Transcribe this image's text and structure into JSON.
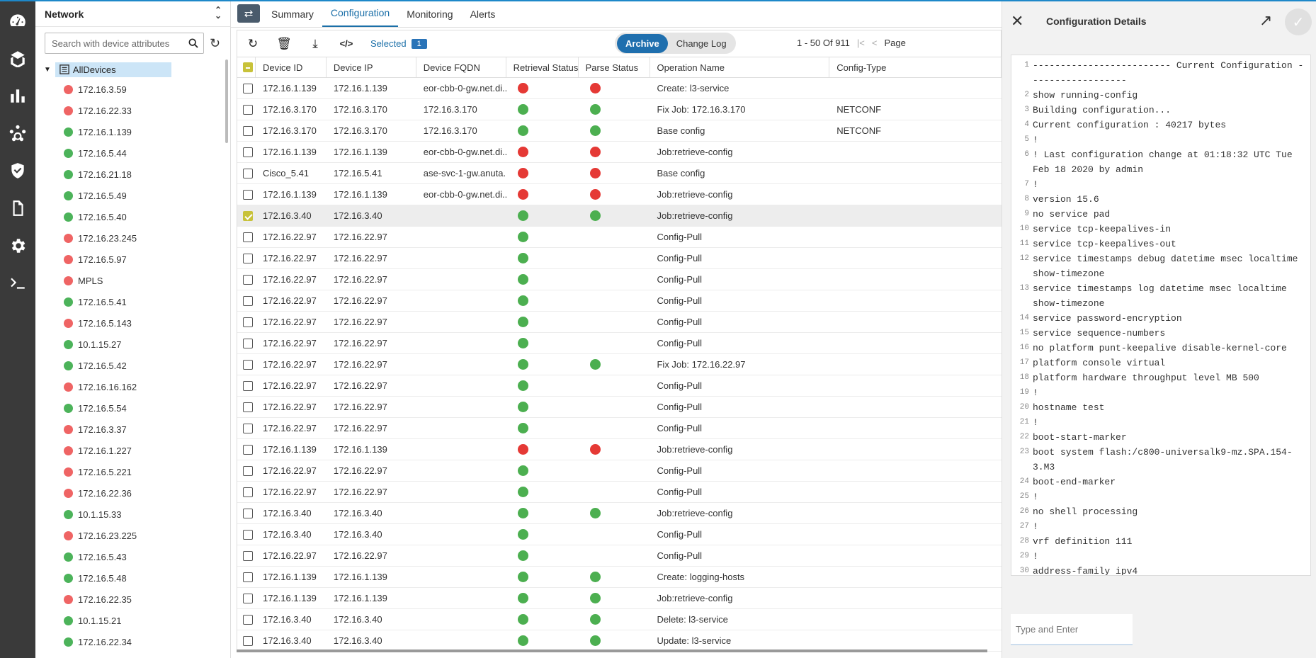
{
  "colors": {
    "accent": "#1b6fa8",
    "rail": "#3a3a3a",
    "red": "#e53935",
    "green": "#4caf50",
    "selected_check": "#c8c23a"
  },
  "rail": {
    "icons": [
      "dashboard-icon",
      "deploy-icon",
      "chart-icon",
      "topology-icon",
      "shield-icon",
      "document-icon",
      "gear-icon",
      "terminal-icon"
    ]
  },
  "tree": {
    "title": "Network",
    "search_placeholder": "Search with device attributes",
    "root_label": "AllDevices",
    "items": [
      {
        "label": "172.16.3.59",
        "status": "red"
      },
      {
        "label": "172.16.22.33",
        "status": "red"
      },
      {
        "label": "172.16.1.139",
        "status": "green"
      },
      {
        "label": "172.16.5.44",
        "status": "green"
      },
      {
        "label": "172.16.21.18",
        "status": "green"
      },
      {
        "label": "172.16.5.49",
        "status": "green"
      },
      {
        "label": "172.16.5.40",
        "status": "green"
      },
      {
        "label": "172.16.23.245",
        "status": "red"
      },
      {
        "label": "172.16.5.97",
        "status": "red"
      },
      {
        "label": "MPLS",
        "status": "red"
      },
      {
        "label": "172.16.5.41",
        "status": "green"
      },
      {
        "label": "172.16.5.143",
        "status": "red"
      },
      {
        "label": "10.1.15.27",
        "status": "green"
      },
      {
        "label": "172.16.5.42",
        "status": "green"
      },
      {
        "label": "172.16.16.162",
        "status": "red"
      },
      {
        "label": "172.16.5.54",
        "status": "green"
      },
      {
        "label": "172.16.3.37",
        "status": "red"
      },
      {
        "label": "172.16.1.227",
        "status": "red"
      },
      {
        "label": "172.16.5.221",
        "status": "red"
      },
      {
        "label": "172.16.22.36",
        "status": "red"
      },
      {
        "label": "10.1.15.33",
        "status": "green"
      },
      {
        "label": "172.16.23.225",
        "status": "red"
      },
      {
        "label": "172.16.5.43",
        "status": "green"
      },
      {
        "label": "172.16.5.48",
        "status": "green"
      },
      {
        "label": "172.16.22.35",
        "status": "red"
      },
      {
        "label": "10.1.15.21",
        "status": "green"
      },
      {
        "label": "172.16.22.34",
        "status": "green"
      }
    ]
  },
  "tabs": [
    "Summary",
    "Configuration",
    "Monitoring",
    "Alerts"
  ],
  "toolbar": {
    "selected_label": "Selected",
    "selected_count": "1",
    "archive_label": "Archive",
    "changelog_label": "Change Log",
    "range": "1 - 50 Of 911",
    "page_label": "Page"
  },
  "grid": {
    "headers": [
      "Device ID",
      "Device IP",
      "Device FQDN",
      "Retrieval Status",
      "Parse Status",
      "Operation Name",
      "Config-Type"
    ],
    "rows": [
      {
        "id": "172.16.1.139",
        "ip": "172.16.1.139",
        "fqdn": "eor-cbb-0-gw.net.di...",
        "ret": "red",
        "parse": "red",
        "op": "Create: l3-service",
        "type": "",
        "checked": false
      },
      {
        "id": "172.16.3.170",
        "ip": "172.16.3.170",
        "fqdn": "172.16.3.170",
        "ret": "green",
        "parse": "green",
        "op": "Fix Job: 172.16.3.170",
        "type": "NETCONF",
        "checked": false
      },
      {
        "id": "172.16.3.170",
        "ip": "172.16.3.170",
        "fqdn": "172.16.3.170",
        "ret": "green",
        "parse": "green",
        "op": "Base config",
        "type": "NETCONF",
        "checked": false
      },
      {
        "id": "172.16.1.139",
        "ip": "172.16.1.139",
        "fqdn": "eor-cbb-0-gw.net.di...",
        "ret": "red",
        "parse": "red",
        "op": "Job:retrieve-config",
        "type": "",
        "checked": false
      },
      {
        "id": "Cisco_5.41",
        "ip": "172.16.5.41",
        "fqdn": "ase-svc-1-gw.anuta...",
        "ret": "red",
        "parse": "red",
        "op": "Base config",
        "type": "",
        "checked": false
      },
      {
        "id": "172.16.1.139",
        "ip": "172.16.1.139",
        "fqdn": "eor-cbb-0-gw.net.di...",
        "ret": "red",
        "parse": "red",
        "op": "Job:retrieve-config",
        "type": "",
        "checked": false
      },
      {
        "id": "172.16.3.40",
        "ip": "172.16.3.40",
        "fqdn": "",
        "ret": "green",
        "parse": "green",
        "op": "Job:retrieve-config",
        "type": "",
        "checked": true
      },
      {
        "id": "172.16.22.97",
        "ip": "172.16.22.97",
        "fqdn": "",
        "ret": "green",
        "parse": "",
        "op": "Config-Pull",
        "type": "",
        "checked": false
      },
      {
        "id": "172.16.22.97",
        "ip": "172.16.22.97",
        "fqdn": "",
        "ret": "green",
        "parse": "",
        "op": "Config-Pull",
        "type": "",
        "checked": false
      },
      {
        "id": "172.16.22.97",
        "ip": "172.16.22.97",
        "fqdn": "",
        "ret": "green",
        "parse": "",
        "op": "Config-Pull",
        "type": "",
        "checked": false
      },
      {
        "id": "172.16.22.97",
        "ip": "172.16.22.97",
        "fqdn": "",
        "ret": "green",
        "parse": "",
        "op": "Config-Pull",
        "type": "",
        "checked": false
      },
      {
        "id": "172.16.22.97",
        "ip": "172.16.22.97",
        "fqdn": "",
        "ret": "green",
        "parse": "",
        "op": "Config-Pull",
        "type": "",
        "checked": false
      },
      {
        "id": "172.16.22.97",
        "ip": "172.16.22.97",
        "fqdn": "",
        "ret": "green",
        "parse": "",
        "op": "Config-Pull",
        "type": "",
        "checked": false
      },
      {
        "id": "172.16.22.97",
        "ip": "172.16.22.97",
        "fqdn": "",
        "ret": "green",
        "parse": "green",
        "op": "Fix Job: 172.16.22.97",
        "type": "",
        "checked": false
      },
      {
        "id": "172.16.22.97",
        "ip": "172.16.22.97",
        "fqdn": "",
        "ret": "green",
        "parse": "",
        "op": "Config-Pull",
        "type": "",
        "checked": false
      },
      {
        "id": "172.16.22.97",
        "ip": "172.16.22.97",
        "fqdn": "",
        "ret": "green",
        "parse": "",
        "op": "Config-Pull",
        "type": "",
        "checked": false
      },
      {
        "id": "172.16.22.97",
        "ip": "172.16.22.97",
        "fqdn": "",
        "ret": "green",
        "parse": "",
        "op": "Config-Pull",
        "type": "",
        "checked": false
      },
      {
        "id": "172.16.1.139",
        "ip": "172.16.1.139",
        "fqdn": "",
        "ret": "red",
        "parse": "red",
        "op": "Job:retrieve-config",
        "type": "",
        "checked": false
      },
      {
        "id": "172.16.22.97",
        "ip": "172.16.22.97",
        "fqdn": "",
        "ret": "green",
        "parse": "",
        "op": "Config-Pull",
        "type": "",
        "checked": false
      },
      {
        "id": "172.16.22.97",
        "ip": "172.16.22.97",
        "fqdn": "",
        "ret": "green",
        "parse": "",
        "op": "Config-Pull",
        "type": "",
        "checked": false
      },
      {
        "id": "172.16.3.40",
        "ip": "172.16.3.40",
        "fqdn": "",
        "ret": "green",
        "parse": "green",
        "op": "Job:retrieve-config",
        "type": "",
        "checked": false
      },
      {
        "id": "172.16.3.40",
        "ip": "172.16.3.40",
        "fqdn": "",
        "ret": "green",
        "parse": "",
        "op": "Config-Pull",
        "type": "",
        "checked": false
      },
      {
        "id": "172.16.22.97",
        "ip": "172.16.22.97",
        "fqdn": "",
        "ret": "green",
        "parse": "",
        "op": "Config-Pull",
        "type": "",
        "checked": false
      },
      {
        "id": "172.16.1.139",
        "ip": "172.16.1.139",
        "fqdn": "",
        "ret": "green",
        "parse": "green",
        "op": "Create: logging-hosts",
        "type": "",
        "checked": false
      },
      {
        "id": "172.16.1.139",
        "ip": "172.16.1.139",
        "fqdn": "",
        "ret": "green",
        "parse": "green",
        "op": "Job:retrieve-config",
        "type": "",
        "checked": false
      },
      {
        "id": "172.16.3.40",
        "ip": "172.16.3.40",
        "fqdn": "",
        "ret": "green",
        "parse": "green",
        "op": "Delete: l3-service",
        "type": "",
        "checked": false
      },
      {
        "id": "172.16.3.40",
        "ip": "172.16.3.40",
        "fqdn": "",
        "ret": "green",
        "parse": "green",
        "op": "Update: l3-service",
        "type": "",
        "checked": false
      }
    ]
  },
  "panel": {
    "title": "Configuration Details",
    "input_placeholder": "Type and Enter",
    "lines": [
      {
        "n": "1",
        "t": "------------------------- Current Configuration ------------------"
      },
      {
        "n": "2",
        "t": "show running-config"
      },
      {
        "n": "3",
        "t": "Building configuration..."
      },
      {
        "n": "4",
        "t": "Current configuration : 40217 bytes"
      },
      {
        "n": "5",
        "t": "!"
      },
      {
        "n": "6",
        "t": "! Last configuration change at 01:18:32 UTC Tue Feb 18 2020 by admin"
      },
      {
        "n": "7",
        "t": "!"
      },
      {
        "n": "8",
        "t": "version 15.6"
      },
      {
        "n": "9",
        "t": "no service pad"
      },
      {
        "n": "10",
        "t": "service tcp-keepalives-in"
      },
      {
        "n": "11",
        "t": "service tcp-keepalives-out"
      },
      {
        "n": "12",
        "t": "service timestamps debug datetime msec localtime show-timezone"
      },
      {
        "n": "13",
        "t": "service timestamps log datetime msec localtime show-timezone"
      },
      {
        "n": "14",
        "t": "service password-encryption"
      },
      {
        "n": "15",
        "t": "service sequence-numbers"
      },
      {
        "n": "16",
        "t": "no platform punt-keepalive disable-kernel-core"
      },
      {
        "n": "17",
        "t": "platform console virtual"
      },
      {
        "n": "18",
        "t": "platform hardware throughput level MB 500"
      },
      {
        "n": "19",
        "t": "!"
      },
      {
        "n": "20",
        "t": "hostname test"
      },
      {
        "n": "21",
        "t": "!"
      },
      {
        "n": "22",
        "t": "boot-start-marker"
      },
      {
        "n": "23",
        "t": "boot system flash:/c800-universalk9-mz.SPA.154-3.M3"
      },
      {
        "n": "24",
        "t": "boot-end-marker"
      },
      {
        "n": "25",
        "t": "!"
      },
      {
        "n": "26",
        "t": "no shell processing"
      },
      {
        "n": "27",
        "t": "!"
      },
      {
        "n": "28",
        "t": "vrf definition 111"
      },
      {
        "n": "29",
        "t": "!"
      },
      {
        "n": "30",
        "t": "address-family ipv4"
      }
    ]
  }
}
